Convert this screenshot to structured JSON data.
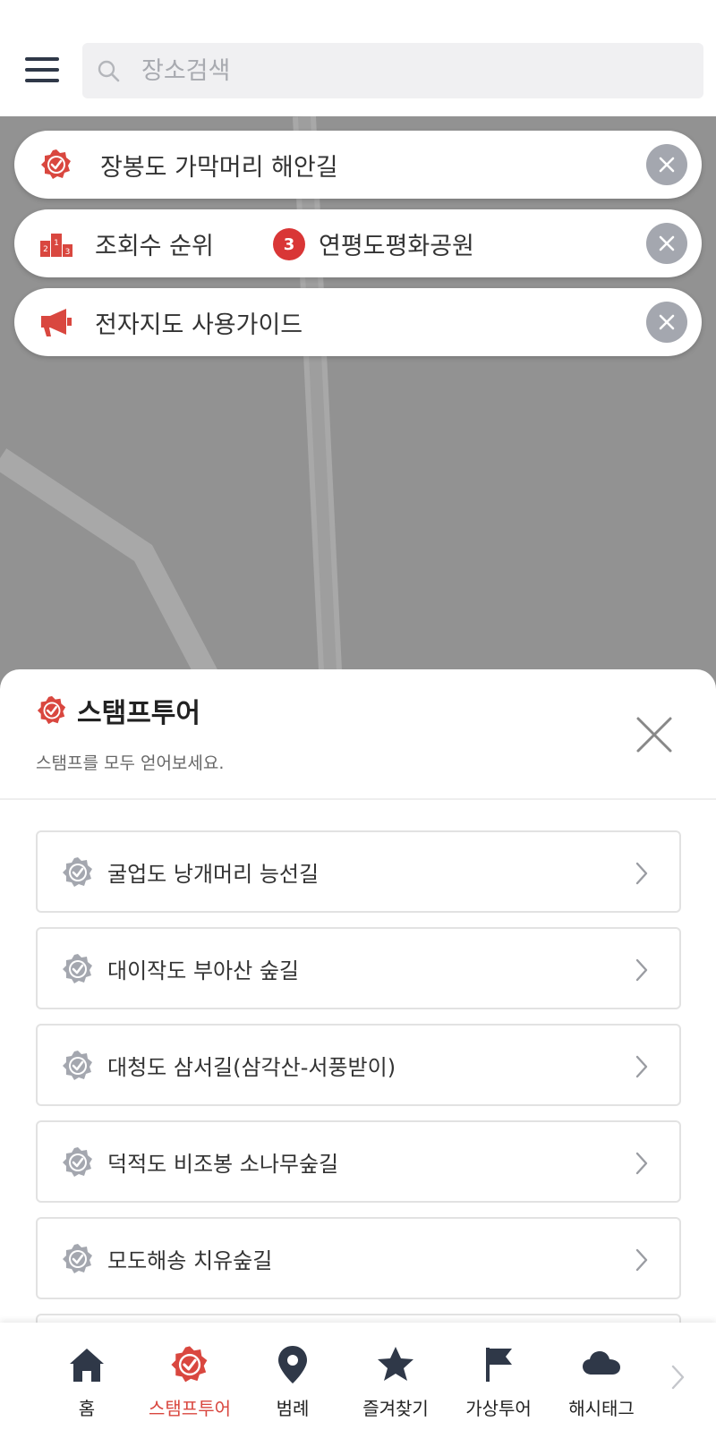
{
  "search": {
    "placeholder": "장소검색"
  },
  "pills": [
    {
      "label": "장봉도 가막머리 해안길",
      "icon": "stamp-icon"
    },
    {
      "label": "조회수 순위",
      "icon": "ranking-podium-icon",
      "rank": "3",
      "rank_label": "연평도평화공원"
    },
    {
      "label": "전자지도 사용가이드",
      "icon": "megaphone-icon"
    }
  ],
  "sheet": {
    "title": "스탬프투어",
    "subtitle": "스탬프를 모두 얻어보세요.",
    "items": [
      {
        "label": "굴업도 낭개머리 능선길"
      },
      {
        "label": "대이작도 부아산 숲길"
      },
      {
        "label": "대청도 삼서길(삼각산-서풍받이)"
      },
      {
        "label": "덕적도 비조봉 소나무숲길"
      },
      {
        "label": "모도해송 치유숲길"
      }
    ]
  },
  "nav": {
    "items": [
      {
        "label": "홈",
        "icon": "home-icon"
      },
      {
        "label": "스탬프투어",
        "icon": "stamp-icon",
        "active": true
      },
      {
        "label": "범례",
        "icon": "map-pin-icon"
      },
      {
        "label": "즐겨찾기",
        "icon": "star-icon"
      },
      {
        "label": "가상투어",
        "icon": "flag-icon"
      },
      {
        "label": "해시태그",
        "icon": "cloud-icon"
      }
    ]
  },
  "colors": {
    "accent": "#d9473f",
    "map": "#929292",
    "icon_gray": "#a4a7af",
    "nav_icon": "#2f3848"
  }
}
